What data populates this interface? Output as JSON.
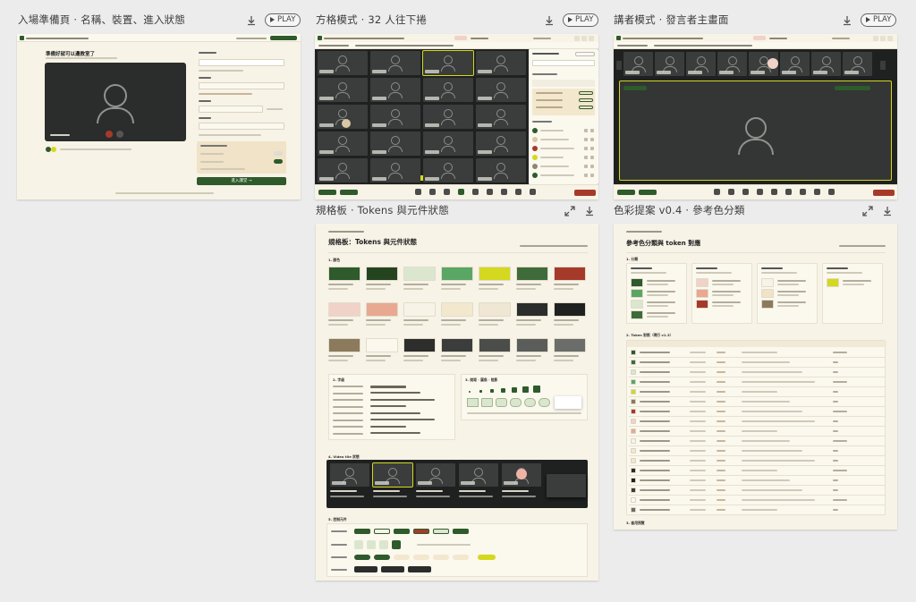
{
  "panels": [
    {
      "title": "入場準備頁 · 名稱、裝置、進入狀態",
      "play": "PLAY"
    },
    {
      "title": "方格模式 · 32 人往下捲",
      "play": "PLAY"
    },
    {
      "title": "講者模式 · 發言者主畫面",
      "play": "PLAY"
    },
    {
      "title": "規格板 · Tokens 與元件狀態"
    },
    {
      "title": "色彩提案 v0.4 · 參考色分類"
    }
  ],
  "lobby": {
    "heading": "準備好就可以邊教室了",
    "enter": "進入課堂 →"
  },
  "spec": {
    "title": "規格板：Tokens 與元件狀態",
    "s1": "1. 顏色",
    "s2": "2. 字級",
    "s3": "3. 間距 · 圓角 · 陰影",
    "s4": "4. Video tile 狀態",
    "s5": "5. 控制元件"
  },
  "palette": {
    "title": "參考色分類與 token 對應",
    "s1": "1. 分類",
    "s2": "2. Token 對照（現行 v1.3）",
    "s3": "3. 套用預覽"
  },
  "colors": {
    "green": "#2e5a2c",
    "lime": "#d4d81e",
    "red": "#a63a2a",
    "cream": "#f7f3e6",
    "dark": "#1f2120"
  }
}
